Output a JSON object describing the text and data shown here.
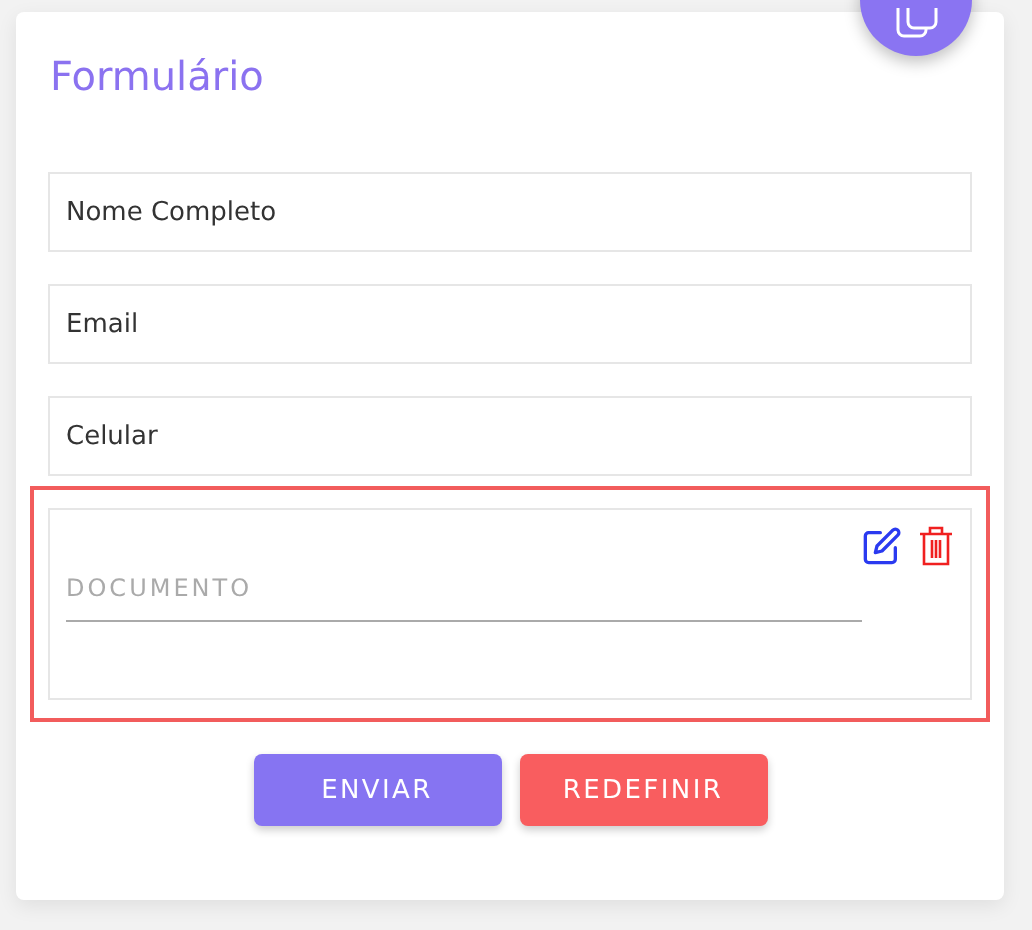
{
  "form": {
    "title": "Formulário",
    "fields": [
      {
        "kind": "boxed",
        "placeholder": "Nome Completo",
        "selected": false
      },
      {
        "kind": "boxed",
        "placeholder": "Email",
        "selected": false
      },
      {
        "kind": "boxed",
        "placeholder": "Celular",
        "selected": false
      },
      {
        "kind": "underlined",
        "placeholder": "DOCUMENTO",
        "selected": true
      }
    ],
    "buttons": [
      {
        "label": "ENVIAR",
        "kind": "primary"
      },
      {
        "label": "REDEFINIR",
        "kind": "danger"
      }
    ]
  }
}
